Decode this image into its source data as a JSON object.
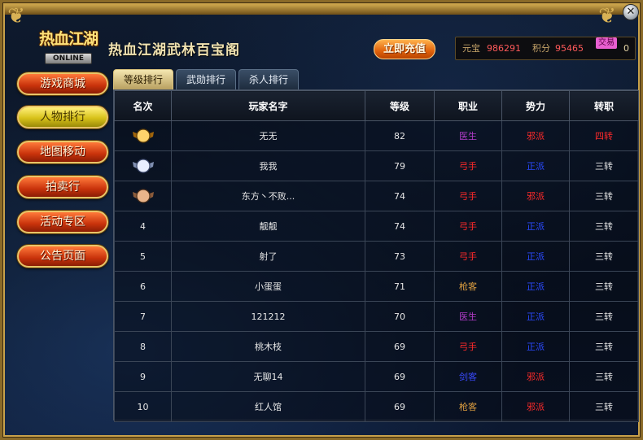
{
  "window": {
    "logo_text": "热血江湖",
    "logo_sub": "ONLINE",
    "title": "热血江湖武林百宝阁",
    "close_label": "✕"
  },
  "header": {
    "recharge_label": "立即充值",
    "currency": {
      "yuanbao_label": "元宝",
      "yuanbao_value": "986291",
      "points_label": "积分",
      "points_value": "95465",
      "trade_label": "交易",
      "trade_value": "0"
    }
  },
  "sidebar": {
    "items": [
      {
        "label": "游戏商城",
        "active": false
      },
      {
        "label": "人物排行",
        "active": true
      },
      {
        "label": "地图移动",
        "active": false
      },
      {
        "label": "拍卖行",
        "active": false
      },
      {
        "label": "活动专区",
        "active": false
      },
      {
        "label": "公告页面",
        "active": false
      }
    ]
  },
  "tabs": [
    {
      "label": "等级排行",
      "active": true
    },
    {
      "label": "武勋排行",
      "active": false
    },
    {
      "label": "杀人排行",
      "active": false
    }
  ],
  "table": {
    "headers": [
      "名次",
      "玩家名字",
      "等级",
      "职业",
      "势力",
      "转职"
    ],
    "rows": [
      {
        "rank": "1",
        "rank_icon": "gold-medal-icon",
        "name": "无无",
        "level": "82",
        "job": "医生",
        "job_color": "#b03cc8",
        "faction": "邪派",
        "faction_color": "#ff2a2a",
        "promotion": "四转",
        "promotion_color": "#ff2a2a"
      },
      {
        "rank": "2",
        "rank_icon": "silver-medal-icon",
        "name": "我我",
        "level": "79",
        "job": "弓手",
        "job_color": "#ff2a2a",
        "faction": "正派",
        "faction_color": "#2a4aff",
        "promotion": "三转",
        "promotion_color": "#e6e6e6"
      },
      {
        "rank": "3",
        "rank_icon": "bronze-medal-icon",
        "name": "东方丶不败...",
        "level": "74",
        "job": "弓手",
        "job_color": "#ff2a2a",
        "faction": "邪派",
        "faction_color": "#ff2a2a",
        "promotion": "三转",
        "promotion_color": "#e6e6e6"
      },
      {
        "rank": "4",
        "rank_icon": "",
        "name": "靓靓",
        "level": "74",
        "job": "弓手",
        "job_color": "#ff2a2a",
        "faction": "正派",
        "faction_color": "#2a4aff",
        "promotion": "三转",
        "promotion_color": "#e6e6e6"
      },
      {
        "rank": "5",
        "rank_icon": "",
        "name": "射了",
        "level": "73",
        "job": "弓手",
        "job_color": "#ff2a2a",
        "faction": "正派",
        "faction_color": "#2a4aff",
        "promotion": "三转",
        "promotion_color": "#e6e6e6"
      },
      {
        "rank": "6",
        "rank_icon": "",
        "name": "小蛋蛋",
        "level": "71",
        "job": "枪客",
        "job_color": "#e0a040",
        "faction": "正派",
        "faction_color": "#2a4aff",
        "promotion": "三转",
        "promotion_color": "#e6e6e6"
      },
      {
        "rank": "7",
        "rank_icon": "",
        "name": "121212",
        "level": "70",
        "job": "医生",
        "job_color": "#b03cc8",
        "faction": "正派",
        "faction_color": "#2a4aff",
        "promotion": "三转",
        "promotion_color": "#e6e6e6"
      },
      {
        "rank": "8",
        "rank_icon": "",
        "name": "桃木枝",
        "level": "69",
        "job": "弓手",
        "job_color": "#ff2a2a",
        "faction": "正派",
        "faction_color": "#2a4aff",
        "promotion": "三转",
        "promotion_color": "#e6e6e6"
      },
      {
        "rank": "9",
        "rank_icon": "",
        "name": "无聊14",
        "level": "69",
        "job": "剑客",
        "job_color": "#3a4aff",
        "faction": "邪派",
        "faction_color": "#ff2a2a",
        "promotion": "三转",
        "promotion_color": "#e6e6e6"
      },
      {
        "rank": "10",
        "rank_icon": "",
        "name": "红人馆",
        "level": "69",
        "job": "枪客",
        "job_color": "#e0a040",
        "faction": "邪派",
        "faction_color": "#ff2a2a",
        "promotion": "三转",
        "promotion_color": "#e6e6e6"
      }
    ]
  }
}
